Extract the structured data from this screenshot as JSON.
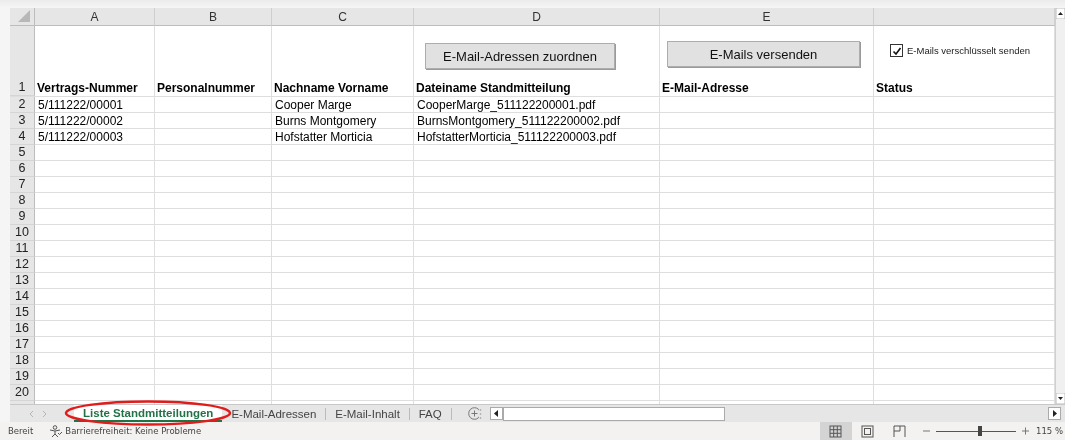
{
  "columns": [
    "A",
    "B",
    "C",
    "D",
    "E"
  ],
  "buttons": [
    {
      "label": "E-Mail-Adressen zuordnen"
    },
    {
      "label": "E-Mails versenden"
    }
  ],
  "checkbox": {
    "label": "E-Mails verschlüsselt senden",
    "checked": true
  },
  "header_row": {
    "number": "1",
    "cells": [
      "Vertrags-Nummer",
      "Personalnummer",
      "Nachname Vorname",
      "Dateiname Standmitteilung",
      "E-Mail-Adresse",
      "Status"
    ]
  },
  "rows": [
    {
      "number": "2",
      "cells": [
        "5/111222/00001",
        null,
        "Cooper Marge",
        "CooperMarge_511122200001.pdf"
      ]
    },
    {
      "number": "3",
      "cells": [
        "5/111222/00002",
        null,
        "Burns Montgomery",
        "BurnsMontgomery_511122200002.pdf"
      ]
    },
    {
      "number": "4",
      "cells": [
        "5/111222/00003",
        null,
        "Hofstatter Morticia",
        "HofstatterMorticia_511122200003.pdf"
      ]
    },
    {
      "number": "5"
    },
    {
      "number": "6"
    },
    {
      "number": "7"
    },
    {
      "number": "8"
    },
    {
      "number": "9"
    },
    {
      "number": "10"
    },
    {
      "number": "11"
    },
    {
      "number": "12"
    },
    {
      "number": "13"
    },
    {
      "number": "14"
    },
    {
      "number": "15"
    },
    {
      "number": "16"
    },
    {
      "number": "17"
    },
    {
      "number": "18"
    },
    {
      "number": "19"
    },
    {
      "number": "20"
    }
  ],
  "sheet_tabs": [
    {
      "label": "Liste Standmitteilungen",
      "selected": true
    },
    {
      "label": "E-Mail-Adressen",
      "selected": false
    },
    {
      "label": "E-Mail-Inhalt",
      "selected": false
    },
    {
      "label": "FAQ",
      "selected": false
    }
  ],
  "annotation": {
    "kind": "ellipse",
    "color": "#e21b1b"
  },
  "status_bar": {
    "mode": "Bereit",
    "accessibility": "Barrierefreiheit: Keine Probleme",
    "views": [
      {
        "kind": "normal",
        "selected": true
      },
      {
        "kind": "layout",
        "selected": false
      },
      {
        "kind": "pagebreak",
        "selected": false
      }
    ],
    "zoom": {
      "level": 0.55,
      "reading": "115 %"
    }
  }
}
